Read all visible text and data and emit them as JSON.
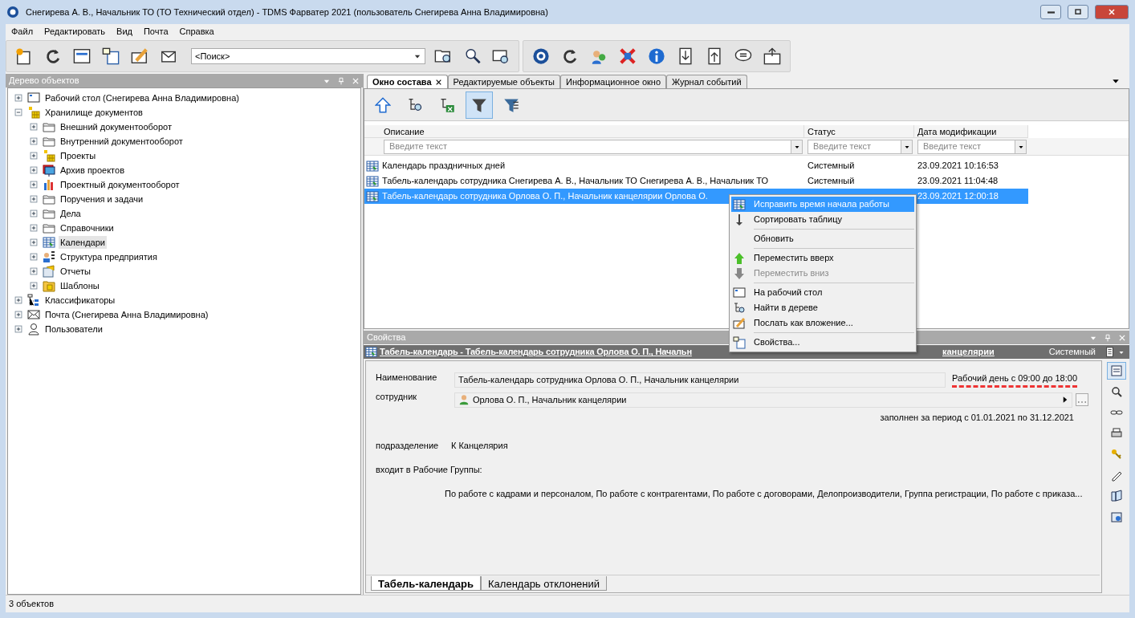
{
  "window": {
    "title": "Снегирева А. В., Начальник ТО (ТО Технический отдел) - TDMS Фарватер 2021 (пользователь Снегирева Анна Владимировна)"
  },
  "menu_bar": [
    "Файл",
    "Редактировать",
    "Вид",
    "Почта",
    "Справка"
  ],
  "search": {
    "value": "<Поиск>"
  },
  "tree_panel": {
    "title": "Дерево объектов",
    "items": [
      {
        "label": "Рабочий стол (Снегирева Анна Владимировна)",
        "expanded": false,
        "selected": false
      },
      {
        "label": "Хранилище документов",
        "expanded": true,
        "selected": false,
        "children": [
          {
            "label": "Внешний документооборот",
            "expanded": false,
            "selected": false
          },
          {
            "label": "Внутренний документооборот",
            "expanded": false,
            "selected": false
          },
          {
            "label": "Проекты",
            "expanded": false,
            "selected": false
          },
          {
            "label": "Архив проектов",
            "expanded": false,
            "selected": false
          },
          {
            "label": "Проектный документооборот",
            "expanded": false,
            "selected": false
          },
          {
            "label": "Поручения и задачи",
            "expanded": false,
            "selected": false
          },
          {
            "label": "Дела",
            "expanded": false,
            "selected": false
          },
          {
            "label": "Справочники",
            "expanded": false,
            "selected": false
          },
          {
            "label": "Календари",
            "expanded": false,
            "selected": true
          },
          {
            "label": "Структура предприятия",
            "expanded": false,
            "selected": false
          },
          {
            "label": "Отчеты",
            "expanded": false,
            "selected": false
          },
          {
            "label": "Шаблоны",
            "expanded": false,
            "selected": false
          }
        ]
      },
      {
        "label": "Классификаторы",
        "expanded": false,
        "selected": false
      },
      {
        "label": "Почта (Снегирева Анна Владимировна)",
        "expanded": false,
        "selected": false
      },
      {
        "label": "Пользователи",
        "expanded": false,
        "selected": false
      }
    ]
  },
  "tabs": [
    {
      "label": "Окно состава",
      "selected": true
    },
    {
      "label": "Редактируемые объекты",
      "selected": false
    },
    {
      "label": "Информационное окно",
      "selected": false
    },
    {
      "label": "Журнал событий",
      "selected": false
    }
  ],
  "content_toolbar": [
    {
      "pressed": false
    },
    {
      "pressed": false
    },
    {
      "pressed": false
    },
    {
      "pressed": true
    },
    {
      "pressed": false
    }
  ],
  "table": {
    "columns": [
      {
        "label": "Описание",
        "filter_placeholder": "Введите текст"
      },
      {
        "label": "Статус",
        "filter_placeholder": "Введите текст"
      },
      {
        "label": "Дата модификации",
        "filter_placeholder": "Введите текст"
      }
    ],
    "rows": [
      {
        "cells": [
          "Календарь праздничных дней",
          "Системный",
          "23.09.2021 10:16:53"
        ],
        "selected": false
      },
      {
        "cells": [
          "Табель-календарь сотрудника Снегирева А. В., Начальник ТО Снегирева А. В., Начальник ТО",
          "Системный",
          "23.09.2021 11:04:48"
        ],
        "selected": false
      },
      {
        "cells": [
          "Табель-календарь сотрудника Орлова О. П., Начальник канцелярии Орлова О.",
          "",
          "23.09.2021 12:00:18"
        ],
        "selected": true
      }
    ]
  },
  "context_menu": [
    [
      {
        "label": "Исправить время начала работы",
        "selected": true,
        "disabled": false
      },
      {
        "label": "Сортировать таблицу",
        "selected": false,
        "disabled": false
      }
    ],
    [
      {
        "label": "Обновить",
        "selected": false,
        "disabled": false
      }
    ],
    [
      {
        "label": "Переместить вверх",
        "selected": false,
        "disabled": false
      },
      {
        "label": "Переместить вниз",
        "selected": false,
        "disabled": true
      }
    ],
    [
      {
        "label": "На рабочий стол",
        "selected": false,
        "disabled": false
      },
      {
        "label": "Найти в дереве",
        "selected": false,
        "disabled": false
      },
      {
        "label": "Послать как вложение...",
        "selected": false,
        "disabled": false
      }
    ],
    [
      {
        "label": "Свойства...",
        "selected": false,
        "disabled": false
      }
    ]
  ],
  "properties": {
    "title": "Свойства",
    "header_left": "Табель-календарь - Табель-календарь сотрудника Орлова О. П., Начальн",
    "header_right": "канцелярии",
    "status": "Системный",
    "name_label": "Наименование",
    "name_value": "Табель-календарь сотрудника Орлова О. П., Начальник канцелярии",
    "work_day": "Рабочий день с 09:00 до 18:00",
    "employee_label": "сотрудник",
    "employee_value": "Орлова О. П., Начальник канцелярии",
    "period": "заполнен за период с 01.01.2021 по 31.12.2021",
    "department_label": "подразделение",
    "department_value": "К Канцелярия",
    "groups_label": "входит в Рабочие Группы:",
    "groups_value": "По работе с кадрами и персоналом, По работе с контрагентами, По работе с договорами, Делопроизводители, Группа регистрации, По работе с приказа...",
    "tabs": [
      {
        "label": "Табель-календарь",
        "selected": true
      },
      {
        "label": "Календарь отклонений",
        "selected": false
      }
    ]
  },
  "status_bar": "3 объектов"
}
